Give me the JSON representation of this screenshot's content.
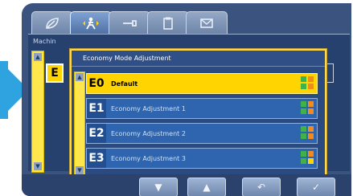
{
  "tabs": [
    {
      "icon": "leaf-icon"
    },
    {
      "icon": "operator-icon",
      "active": true
    },
    {
      "icon": "tool-icon"
    },
    {
      "icon": "clipboard-icon"
    },
    {
      "icon": "mail-icon"
    }
  ],
  "background": {
    "label": "Machin",
    "mode_code": "E"
  },
  "dialog": {
    "title": "Economy Mode Adjustment",
    "items": [
      {
        "code": "E0",
        "label": "Default",
        "selected": true
      },
      {
        "code": "E1",
        "label": "Economy Adjustment 1",
        "selected": false
      },
      {
        "code": "E2",
        "label": "Economy Adjustment 2",
        "selected": false
      },
      {
        "code": "E3",
        "label": "Economy Adjustment 3",
        "selected": false
      }
    ]
  },
  "footer": {
    "buttons": [
      {
        "name": "down-button",
        "symbol": "▼"
      },
      {
        "name": "up-button",
        "symbol": "▲"
      },
      {
        "name": "back-button",
        "symbol": "↶"
      },
      {
        "name": "confirm-button",
        "symbol": "✓"
      }
    ]
  },
  "colors": {
    "accent": "#ffd400",
    "indicator_green": "#3db34a",
    "indicator_orange": "#f28a1c"
  }
}
